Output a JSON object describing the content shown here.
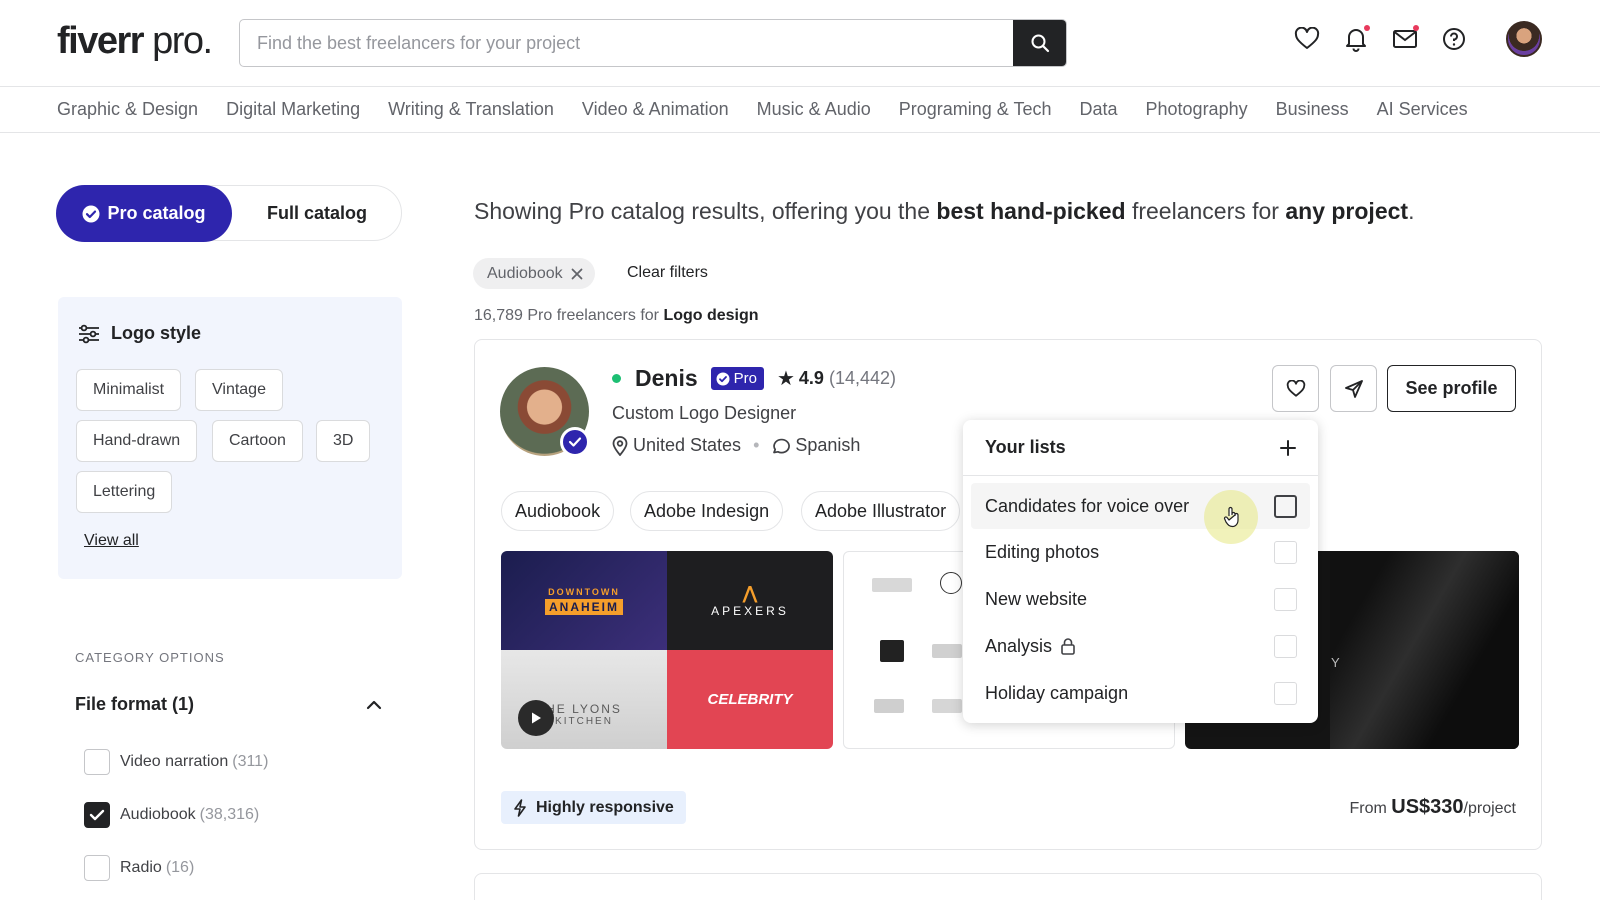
{
  "header": {
    "logo_main": "fiverr",
    "logo_suffix": " pro.",
    "search_placeholder": "Find the best freelancers for your project"
  },
  "icons": {
    "search": "search-icon",
    "favorites": "heart-icon",
    "notifications": "bell-icon",
    "messages": "envelope-icon",
    "help": "question-icon"
  },
  "nav": {
    "categories": [
      "Graphic & Design",
      "Digital Marketing",
      "Writing & Translation",
      "Video & Animation",
      "Music & Audio",
      "Programing & Tech",
      "Data",
      "Photography",
      "Business",
      "AI Services"
    ]
  },
  "catalog": {
    "pro_label": "Pro catalog",
    "full_label": "Full catalog"
  },
  "logo_style": {
    "title": "Logo style",
    "options": [
      "Minimalist",
      "Vintage",
      "Hand-drawn",
      "Cartoon",
      "3D",
      "Lettering"
    ],
    "view_all": "View all"
  },
  "category_options": {
    "heading": "CATEGORY OPTIONS",
    "file_format_label": "File format (1)",
    "items": [
      {
        "label": "Video narration",
        "count": "(311)",
        "checked": false
      },
      {
        "label": "Audiobook",
        "count": "(38,316)",
        "checked": true
      },
      {
        "label": "Radio",
        "count": "(16)",
        "checked": false
      }
    ]
  },
  "main": {
    "headline_pre": "Showing Pro catalog results, offering you the ",
    "headline_b1": "best hand-picked",
    "headline_mid": " freelancers for ",
    "headline_b2": "any project",
    "headline_end": ".",
    "active_filter": "Audiobook",
    "clear_filters": "Clear filters",
    "count_text": "16,789 Pro freelancers for ",
    "count_query": "Logo design"
  },
  "seller": {
    "name": "Denis",
    "pro_badge": "Pro",
    "rating": "4.9",
    "reviews": "(14,442)",
    "title": "Custom Logo Designer",
    "country": "United States",
    "language": "Spanish",
    "skills": [
      "Audiobook",
      "Adobe Indesign",
      "Adobe Illustrator"
    ],
    "see_profile": "See profile",
    "highly_responsive": "Highly responsive",
    "price_from": "From ",
    "price": "US$330",
    "price_unit": "/project",
    "online_color": "#1dbf73"
  },
  "thumbnails": {
    "t1": "DOWNTOWN",
    "t1b": "ANAHEIM",
    "t2": "APEXERS",
    "t3": "HE LYONS",
    "t3b": "KITCHEN",
    "t4": "CELEBRITY",
    "t5": "Y"
  },
  "lists_menu": {
    "title": "Your lists",
    "items": [
      {
        "label": "Candidates for voice over",
        "locked": false
      },
      {
        "label": "Editing photos",
        "locked": false
      },
      {
        "label": "New website",
        "locked": false
      },
      {
        "label": "Analysis",
        "locked": true
      },
      {
        "label": "Holiday campaign",
        "locked": false
      }
    ]
  },
  "colors": {
    "brand_pro": "#2e25ad",
    "panel_bg": "#f2f5fd",
    "notif_dot": "#e8395c"
  }
}
